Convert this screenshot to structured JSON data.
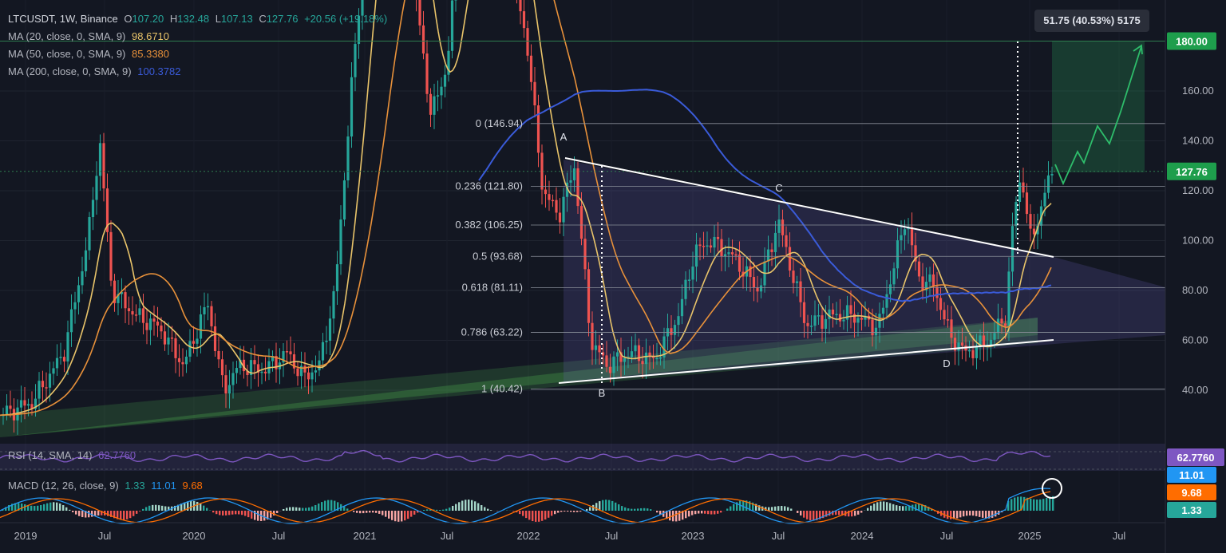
{
  "header": {
    "symbol_line": "LTCUSDT, 1W, Binance",
    "open_label": "O",
    "open_value": "107.20",
    "high_label": "H",
    "high_value": "132.48",
    "low_label": "L",
    "low_value": "107.13",
    "close_label": "C",
    "close_value": "127.76",
    "change": "+20.56 (+19.18%)"
  },
  "indicators": [
    {
      "label": "MA (20, close, 0, SMA, 9)",
      "value": "98.6710",
      "color": "#e9c46a"
    },
    {
      "label": "MA (50, close, 0, SMA, 9)",
      "value": "85.3380",
      "color": "#e8913a"
    },
    {
      "label": "MA (200, close, 0, SMA, 9)",
      "value": "100.3782",
      "color": "#3a5bd9"
    }
  ],
  "measure_box": "51.75 (40.53%) 5175",
  "colors": {
    "background": "#131722",
    "up": "#26a69a",
    "down": "#ef5350",
    "target": "#1e9e4c",
    "price_tag": "#1e9e4c",
    "rsi": "#7e57c2",
    "macd_line": "#2196f3",
    "signal_line": "#ff6d00"
  },
  "chart_data": [
    {
      "type": "line",
      "title": "LTCUSDT, 1W, Binance",
      "x": [
        "2019",
        "Jul",
        "2020",
        "Jul",
        "2021",
        "Jul",
        "2022",
        "Jul",
        "2023",
        "Jul",
        "2024",
        "Jul",
        "2025",
        "Jul"
      ],
      "ylim": [
        30,
        200
      ],
      "y_ticks": [
        "180.00",
        "160.00",
        "140.00",
        "120.00",
        "100.00",
        "80.00",
        "60.00",
        "40.00"
      ],
      "last_price": "127.76",
      "target_price": "180.00",
      "fib_levels": [
        {
          "label": "0 (146.94)",
          "value": 146.94
        },
        {
          "label": "0.236 (121.80)",
          "value": 121.8
        },
        {
          "label": "0.382 (106.25)",
          "value": 106.25
        },
        {
          "label": "0.5 (93.68)",
          "value": 93.68
        },
        {
          "label": "0.618 (81.11)",
          "value": 81.11
        },
        {
          "label": "0.786 (63.22)",
          "value": 63.22
        },
        {
          "label": "1 (40.42)",
          "value": 40.42
        }
      ],
      "pattern_points": [
        "A",
        "B",
        "C",
        "D"
      ],
      "series": [
        {
          "name": "MA (20, close, 0, SMA, 9)",
          "values": [
            45,
            60,
            95,
            85,
            55,
            85,
            50,
            55,
            180,
            185,
            110,
            55,
            70,
            80,
            90,
            85,
            80,
            85,
            70,
            96,
            98.67
          ]
        },
        {
          "name": "MA (50, close, 0, SMA, 9)",
          "values": [
            120,
            70,
            65,
            80,
            75,
            50,
            55,
            130,
            185,
            160,
            100,
            60,
            80,
            85,
            78,
            88,
            80,
            75,
            78,
            85.34
          ]
        },
        {
          "name": "MA (200, close, 0, SMA, 9)",
          "values": [
            101,
            99,
            98,
            99,
            100,
            101,
            102,
            104,
            106,
            104,
            100.38
          ]
        }
      ]
    },
    {
      "type": "line",
      "title": "RSI (14, SMA, 14)",
      "series": [
        {
          "name": "RSI (14, SMA, 14)",
          "values": [
            55,
            45,
            60,
            50,
            65,
            55,
            45,
            60,
            48,
            52,
            58,
            50,
            56,
            66,
            62.776
          ]
        }
      ],
      "last_value": "62.7760",
      "value_label": "62.7760"
    },
    {
      "type": "bar",
      "title": "MACD (12, 26, close, 9)",
      "values_text": [
        "1.33",
        "11.01",
        "9.68"
      ],
      "series": [
        {
          "name": "MACD",
          "value": 11.01
        },
        {
          "name": "Signal",
          "value": 9.68
        },
        {
          "name": "Histogram",
          "value": 1.33
        }
      ]
    }
  ]
}
